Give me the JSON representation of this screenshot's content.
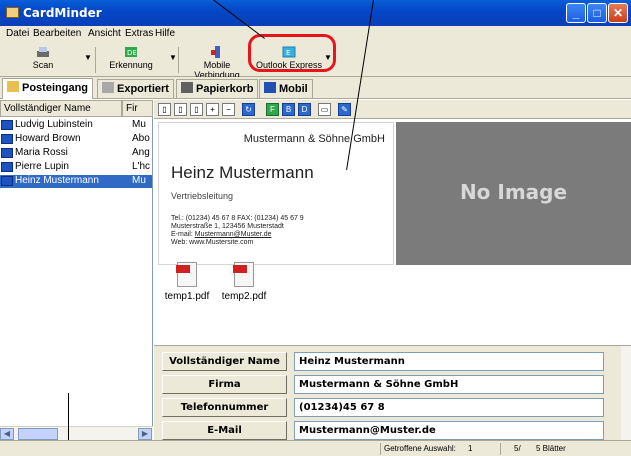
{
  "window": {
    "title": "CardMinder"
  },
  "menu": [
    "Datei",
    "Bearbeiten",
    "Ansicht",
    "Extras",
    "Hilfe"
  ],
  "toolbar": {
    "scan": "Scan",
    "erkennung": "Erkennung",
    "mobile": "Mobile Verbindung",
    "outlook": "Outlook Express"
  },
  "tabs": [
    "Posteingang",
    "Exportiert",
    "Papierkorb",
    "Mobil"
  ],
  "list": {
    "col_name": "Vollständiger Name",
    "col_firm": "Fir",
    "rows": [
      {
        "name": "Ludvig Lubinstein",
        "firm": "Mu"
      },
      {
        "name": "Howard Brown",
        "firm": "Abo"
      },
      {
        "name": "Maria Rossi",
        "firm": "Ang"
      },
      {
        "name": "Pierre Lupin",
        "firm": "L'hc"
      },
      {
        "name": "Heinz Mustermann",
        "firm": "Mu"
      }
    ]
  },
  "card": {
    "company": "Mustermann & Söhne GmbH",
    "name": "Heinz Mustermann",
    "role": "Vertriebsleitung",
    "line1": "Tel.: (01234) 45 67 8 FAX: (01234) 45 67 9",
    "line2": "Musterstraße 1, 123456 Musterstadt",
    "line3_prefix": "E-mail: ",
    "line3_email": "Mustermann@Muster.de",
    "line4": "Web: www.Mustersite.com",
    "back": "No Image"
  },
  "files": [
    "temp1.pdf",
    "temp2.pdf"
  ],
  "fields": [
    {
      "label": "Vollständiger Name",
      "value": "Heinz Mustermann"
    },
    {
      "label": "Firma",
      "value": "Mustermann & Söhne GmbH"
    },
    {
      "label": "Telefonnummer",
      "value": "(01234)45 67 8"
    },
    {
      "label": "E-Mail",
      "value": "Mustermann@Muster.de"
    }
  ],
  "status": {
    "selection_label": "Getroffene Auswahl:",
    "selection_count": "1",
    "page": "5/",
    "sheets": "5 Blätter"
  },
  "colors": {
    "highlight": "#e8141c",
    "selection": "#316ac5",
    "titlebar": "#0447c7"
  },
  "icons": [
    "app-icon",
    "scan-icon",
    "recognition-icon",
    "mobile-icon",
    "outlook-icon",
    "pdf-icon"
  ]
}
